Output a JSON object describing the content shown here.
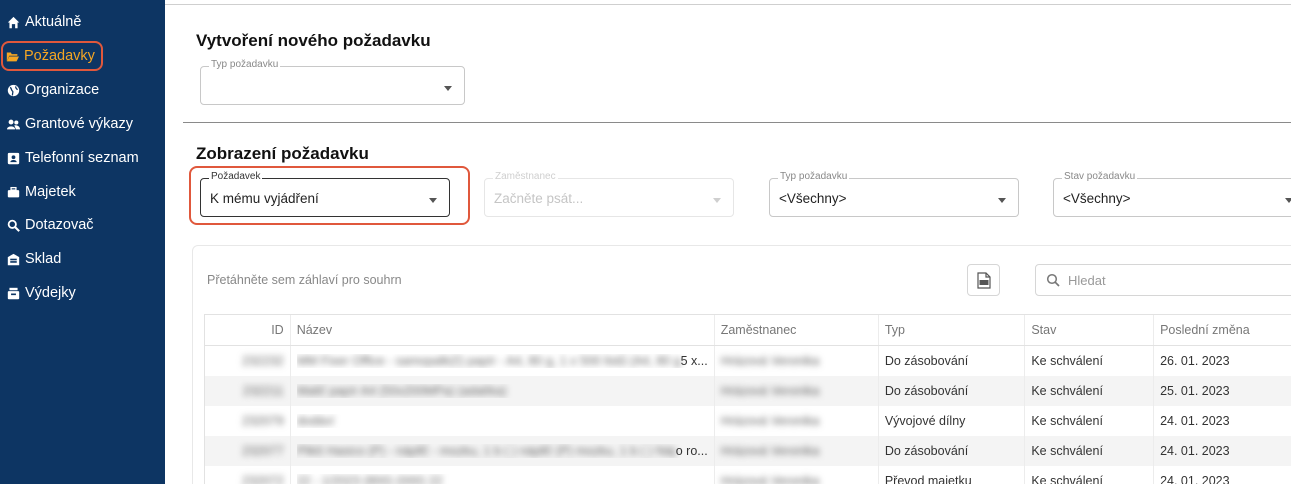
{
  "sidebar": {
    "items": [
      {
        "label": "Aktuálně",
        "icon": "home-icon"
      },
      {
        "label": "Požadavky",
        "icon": "folder-open-icon",
        "active": true
      },
      {
        "label": "Organizace",
        "icon": "globe-icon"
      },
      {
        "label": "Grantové výkazy",
        "icon": "users-icon"
      },
      {
        "label": "Telefonní seznam",
        "icon": "address-card-icon"
      },
      {
        "label": "Majetek",
        "icon": "briefcase-icon"
      },
      {
        "label": "Dotazovač",
        "icon": "search-icon"
      },
      {
        "label": "Sklad",
        "icon": "warehouse-icon"
      },
      {
        "label": "Výdejky",
        "icon": "dispense-icon"
      }
    ]
  },
  "create": {
    "title": "Vytvoření nového požadavku",
    "type_label": "Typ požadavku",
    "type_value": ""
  },
  "view": {
    "title": "Zobrazení požadavku",
    "filters": {
      "request": {
        "label": "Požadavek",
        "value": "K mému vyjádření"
      },
      "employee": {
        "label": "Zaměstnanec",
        "placeholder": "Začněte psát..."
      },
      "type": {
        "label": "Typ požadavku",
        "value": "<Všechny>"
      },
      "state": {
        "label": "Stav požadavku",
        "value": "<Všechny>"
      }
    }
  },
  "grid": {
    "group_hint": "Přetáhněte sem záhlaví pro souhrn",
    "search_placeholder": "Hledat",
    "export_icon": "xlsx-export-icon",
    "columns": {
      "id": "ID",
      "name": "Název",
      "employee": "Zaměstnanec",
      "type": "Typ",
      "state": "Stav",
      "changed": "Poslední změna"
    },
    "rows": [
      {
        "id": "232232",
        "name": "MM Fixer Office - samopalk(č) papír - A4, 80 g, 1 x 500 listů (A4, 80 g,",
        "name_tail": " 5 x...",
        "employee": "Hrázová Veronika",
        "type": "Do zásobování",
        "state": "Ke schválení",
        "changed": "26. 01. 2023"
      },
      {
        "id": "232211",
        "name": "Malič papír A4 (50x200MPa) (adalíka)",
        "name_tail": "",
        "employee": "Hrázová Veronika",
        "type": "Do zásobování",
        "state": "Ke schválení",
        "changed": "25. 01. 2023"
      },
      {
        "id": "232079",
        "name": "dodáví",
        "name_tail": "",
        "employee": "Hrázová Veronika",
        "type": "Vývojové dílny",
        "state": "Ke schválení",
        "changed": "24. 01. 2023"
      },
      {
        "id": "232077",
        "name": "Plikš Hasico (P) - nápllč - mozku, 1 b ( ) nápllč (P) mozku, 1 b ( ) Nápll a",
        "name_tail": "o ro...",
        "employee": "Hrázová Veronika",
        "type": "Do zásobování",
        "state": "Ke schválení",
        "changed": "24. 01. 2023"
      },
      {
        "id": "232072",
        "name": "22 - 1/2023 (800) (000) 22",
        "name_tail": "",
        "employee": "Hrázová Veronika",
        "type": "Převod majetku",
        "state": "Ke schválení",
        "changed": "24. 01. 2023"
      }
    ]
  }
}
